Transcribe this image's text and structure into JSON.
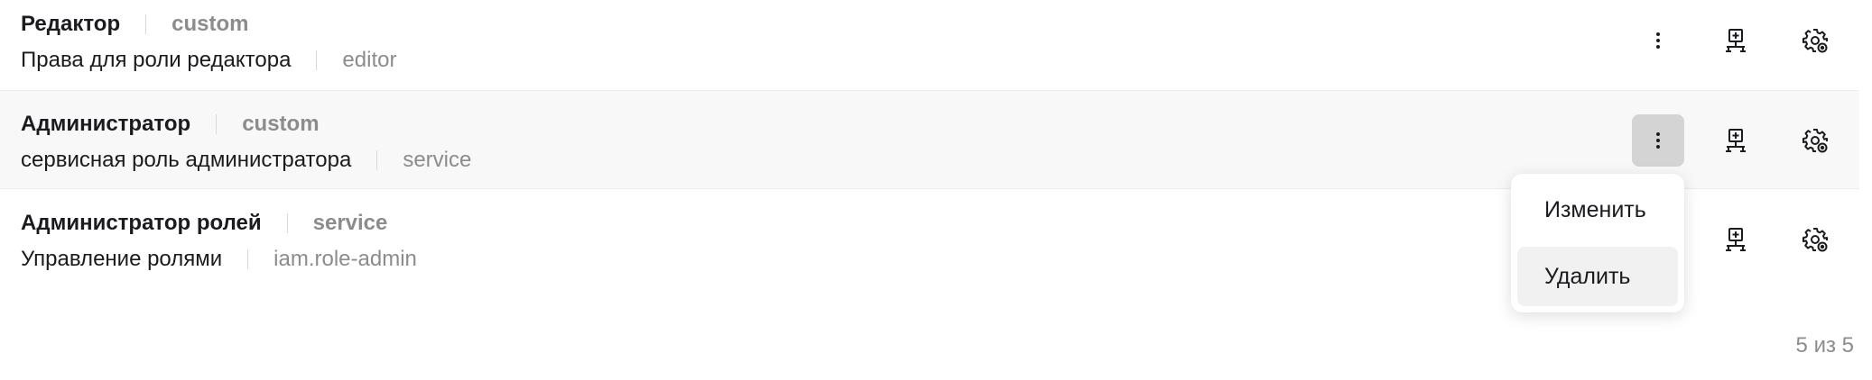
{
  "roles": [
    {
      "name": "Редактор",
      "type": "custom",
      "description": "Права для роли редактора",
      "code": "editor"
    },
    {
      "name": "Администратор",
      "type": "custom",
      "description": "сервисная роль администратора",
      "code": "service"
    },
    {
      "name": "Администратор ролей",
      "type": "service",
      "description": "Управление ролями",
      "code": "iam.role-admin"
    }
  ],
  "actions": {
    "kebab_icon": "more-vertical-icon",
    "tree_icon": "hierarchy-add-icon",
    "gear_icon": "settings-icon"
  },
  "context_menu": {
    "items": [
      "Изменить",
      "Удалить"
    ]
  },
  "pagination": {
    "text": "5 из 5"
  },
  "colors": {
    "text": "#1b1b1f",
    "muted": "#8c8c8c",
    "hover_row": "#f8f8f8",
    "active_button": "#d4d4d4"
  }
}
